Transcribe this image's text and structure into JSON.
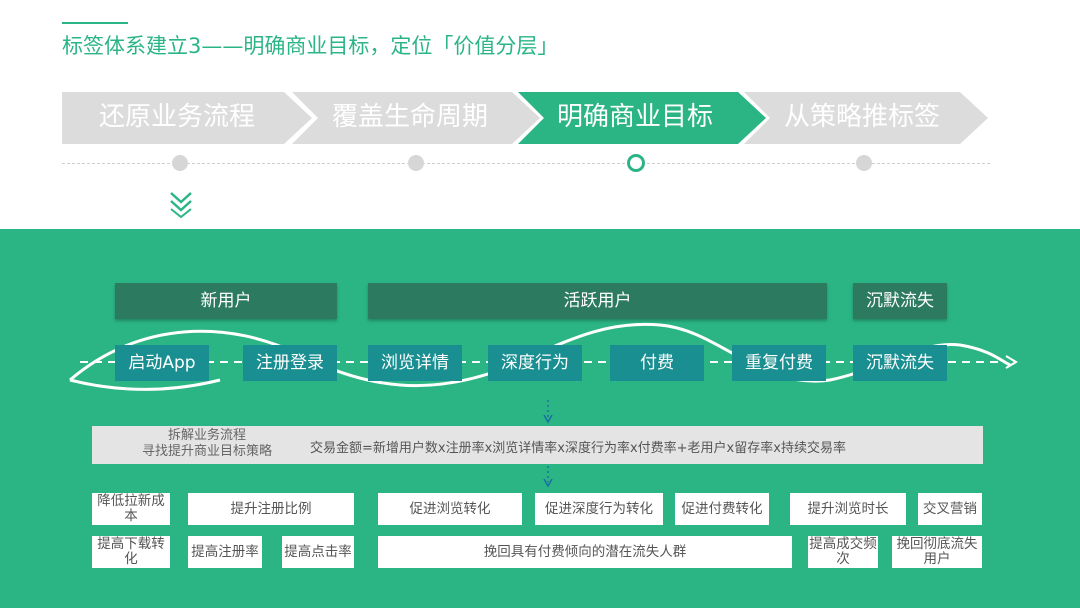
{
  "title": "标签体系建立3——明确商业目标，定位「价值分层」",
  "steps": [
    {
      "label": "还原业务流程"
    },
    {
      "label": "覆盖生命周期"
    },
    {
      "label": "明确商业目标"
    },
    {
      "label": "从策略推标签"
    }
  ],
  "active_step": "明确商业目标",
  "stages": {
    "new_user": "新用户",
    "active_user": "活跃用户",
    "silent": "沉默流失"
  },
  "flow": [
    {
      "label": "启动App"
    },
    {
      "label": "注册登录"
    },
    {
      "label": "浏览详情"
    },
    {
      "label": "深度行为"
    },
    {
      "label": "付费"
    },
    {
      "label": "重复付费"
    },
    {
      "label": "沉默流失"
    }
  ],
  "analysis": {
    "left_line1": "拆解业务流程",
    "left_line2": "寻找提升商业目标策略",
    "formula": "交易金额=新增用户数x注册率x浏览详情率x深度行为率x付费率+老用户x留存率x持续交易率"
  },
  "strategies": {
    "reduce_cost": "降低拉新成本",
    "raise_download": "提高下载转化",
    "raise_register_ratio": "提升注册比例",
    "raise_register_rate": "提高注册率",
    "raise_click_rate": "提高点击率",
    "promote_browse": "促进浏览转化",
    "promote_deep": "促进深度行为转化",
    "promote_pay": "促进付费转化",
    "recover_churn": "挽回具有付费倾向的潜在流失人群",
    "raise_browse_time": "提升浏览时长",
    "cross_sell": "交叉营销",
    "raise_deal_freq": "提高成交频次",
    "recover_lost": "挽回彻底流失用户"
  },
  "colors": {
    "brand_green": "#2bb585",
    "stage_dark": "#2c7a60",
    "flow_teal": "#1a8f92",
    "step_gray": "#dcdcdc"
  }
}
